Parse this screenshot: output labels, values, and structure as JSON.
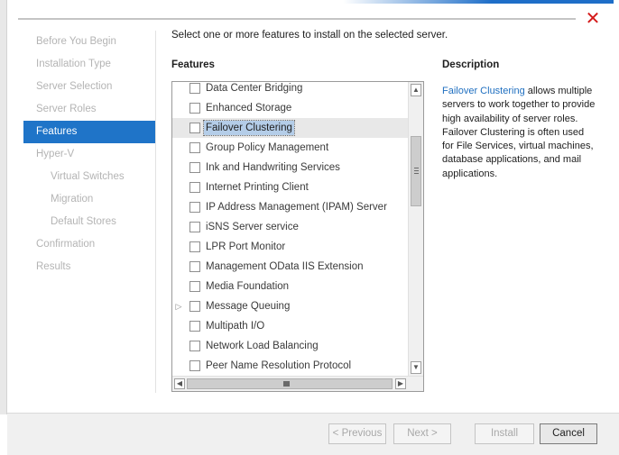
{
  "window": {
    "close_glyph": "✕",
    "accent_color": "#1e6ec8",
    "close_color": "#d41a1a"
  },
  "nav": {
    "items": [
      {
        "label": "Before You Begin",
        "state": "disabled",
        "level": 0
      },
      {
        "label": "Installation Type",
        "state": "disabled",
        "level": 0
      },
      {
        "label": "Server Selection",
        "state": "disabled",
        "level": 0
      },
      {
        "label": "Server Roles",
        "state": "disabled",
        "level": 0
      },
      {
        "label": "Features",
        "state": "active",
        "level": 0
      },
      {
        "label": "Hyper-V",
        "state": "disabled",
        "level": 0
      },
      {
        "label": "Virtual Switches",
        "state": "disabled",
        "level": 1
      },
      {
        "label": "Migration",
        "state": "disabled",
        "level": 1
      },
      {
        "label": "Default Stores",
        "state": "disabled",
        "level": 1
      },
      {
        "label": "Confirmation",
        "state": "disabled",
        "level": 0
      },
      {
        "label": "Results",
        "state": "disabled",
        "level": 0
      }
    ],
    "active_color": "#1f74c8"
  },
  "main": {
    "instruction": "Select one or more features to install on the selected server.",
    "features_heading": "Features",
    "features": [
      {
        "label": "Data Center Bridging",
        "checked": false,
        "expandable": false,
        "selected": false
      },
      {
        "label": "Enhanced Storage",
        "checked": false,
        "expandable": false,
        "selected": false
      },
      {
        "label": "Failover Clustering",
        "checked": false,
        "expandable": false,
        "selected": true
      },
      {
        "label": "Group Policy Management",
        "checked": false,
        "expandable": false,
        "selected": false
      },
      {
        "label": "Ink and Handwriting Services",
        "checked": false,
        "expandable": false,
        "selected": false
      },
      {
        "label": "Internet Printing Client",
        "checked": false,
        "expandable": false,
        "selected": false
      },
      {
        "label": "IP Address Management (IPAM) Server",
        "checked": false,
        "expandable": false,
        "selected": false
      },
      {
        "label": "iSNS Server service",
        "checked": false,
        "expandable": false,
        "selected": false
      },
      {
        "label": "LPR Port Monitor",
        "checked": false,
        "expandable": false,
        "selected": false
      },
      {
        "label": "Management OData IIS Extension",
        "checked": false,
        "expandable": false,
        "selected": false
      },
      {
        "label": "Media Foundation",
        "checked": false,
        "expandable": false,
        "selected": false
      },
      {
        "label": "Message Queuing",
        "checked": false,
        "expandable": true,
        "selected": false
      },
      {
        "label": "Multipath I/O",
        "checked": false,
        "expandable": false,
        "selected": false
      },
      {
        "label": "Network Load Balancing",
        "checked": false,
        "expandable": false,
        "selected": false
      },
      {
        "label": "Peer Name Resolution Protocol",
        "checked": false,
        "expandable": false,
        "selected": false
      }
    ],
    "scrollbar": {
      "up_glyph": "▲",
      "down_glyph": "▼",
      "left_glyph": "◀",
      "right_glyph": "▶"
    }
  },
  "description": {
    "heading": "Description",
    "link_text": "Failover Clustering",
    "body": " allows multiple servers to work together to provide high availability of server roles. Failover Clustering is often used for File Services, virtual machines, database applications, and mail applications.",
    "link_color": "#1f6fc0"
  },
  "footer": {
    "previous_label": "< Previous",
    "next_label": "Next >",
    "install_label": "Install",
    "cancel_label": "Cancel"
  }
}
